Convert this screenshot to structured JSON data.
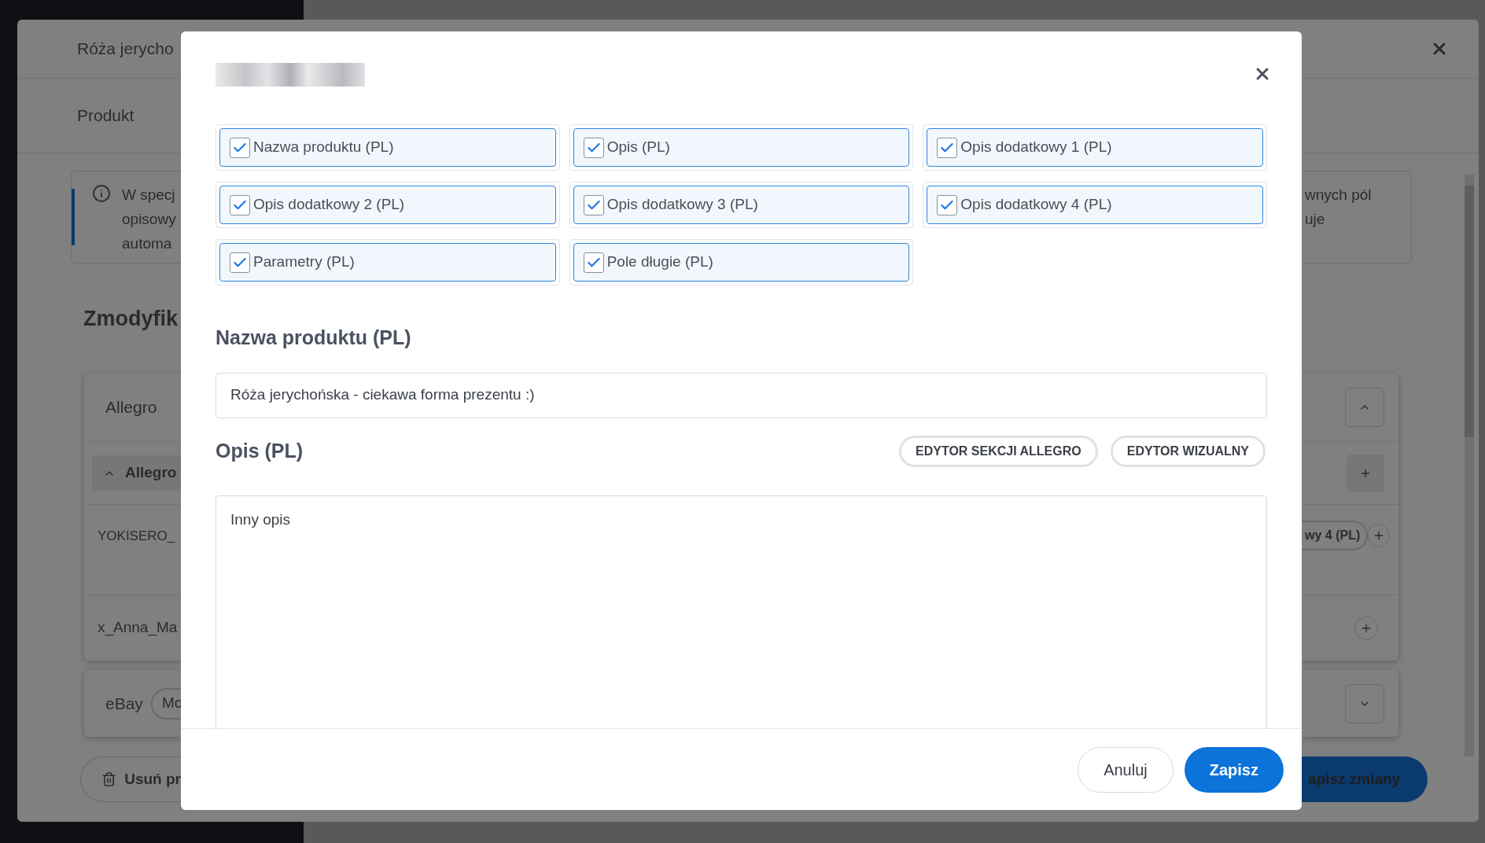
{
  "background_dialog": {
    "title": "Róża jerycho",
    "tab": "Produkt",
    "info_left": [
      "W specj",
      "opisowy",
      "automa"
    ],
    "info_right": [
      "wnych pól",
      "uje"
    ],
    "section_heading": "Zmodyfik",
    "cards": [
      {
        "name": "Allegro",
        "expanded": true,
        "subgroup": {
          "label": "Allegro",
          "expanded": true
        },
        "rows": [
          {
            "name": "YOKISERO_",
            "chip": "wy 4 (PL)"
          },
          {
            "name": "x_Anna_Ma"
          }
        ]
      },
      {
        "name": "eBay",
        "expanded": false,
        "chip": "Mo"
      }
    ],
    "delete_button": "Usuń pr",
    "save_button": "apisz zmiany"
  },
  "modal": {
    "fields": [
      {
        "label": "Nazwa produktu (PL)",
        "checked": true
      },
      {
        "label": "Opis (PL)",
        "checked": true
      },
      {
        "label": "Opis dodatkowy 1 (PL)",
        "checked": true
      },
      {
        "label": "Opis dodatkowy 2 (PL)",
        "checked": true
      },
      {
        "label": "Opis dodatkowy 3 (PL)",
        "checked": true
      },
      {
        "label": "Opis dodatkowy 4 (PL)",
        "checked": true
      },
      {
        "label": "Parametry (PL)",
        "checked": true
      },
      {
        "label": "Pole długie (PL)",
        "checked": true
      }
    ],
    "name_heading": "Nazwa produktu (PL)",
    "name_value": "Róża jerychońska - ciekawa forma prezentu :)",
    "description_heading": "Opis (PL)",
    "editor_buttons": [
      "EDYTOR SEKCJI ALLEGRO",
      "EDYTOR WIZUALNY"
    ],
    "description_value": "Inny opis",
    "buttons": [
      {
        "label": "Anuluj",
        "kind": "secondary"
      },
      {
        "label": "Zapisz",
        "kind": "primary"
      }
    ]
  }
}
